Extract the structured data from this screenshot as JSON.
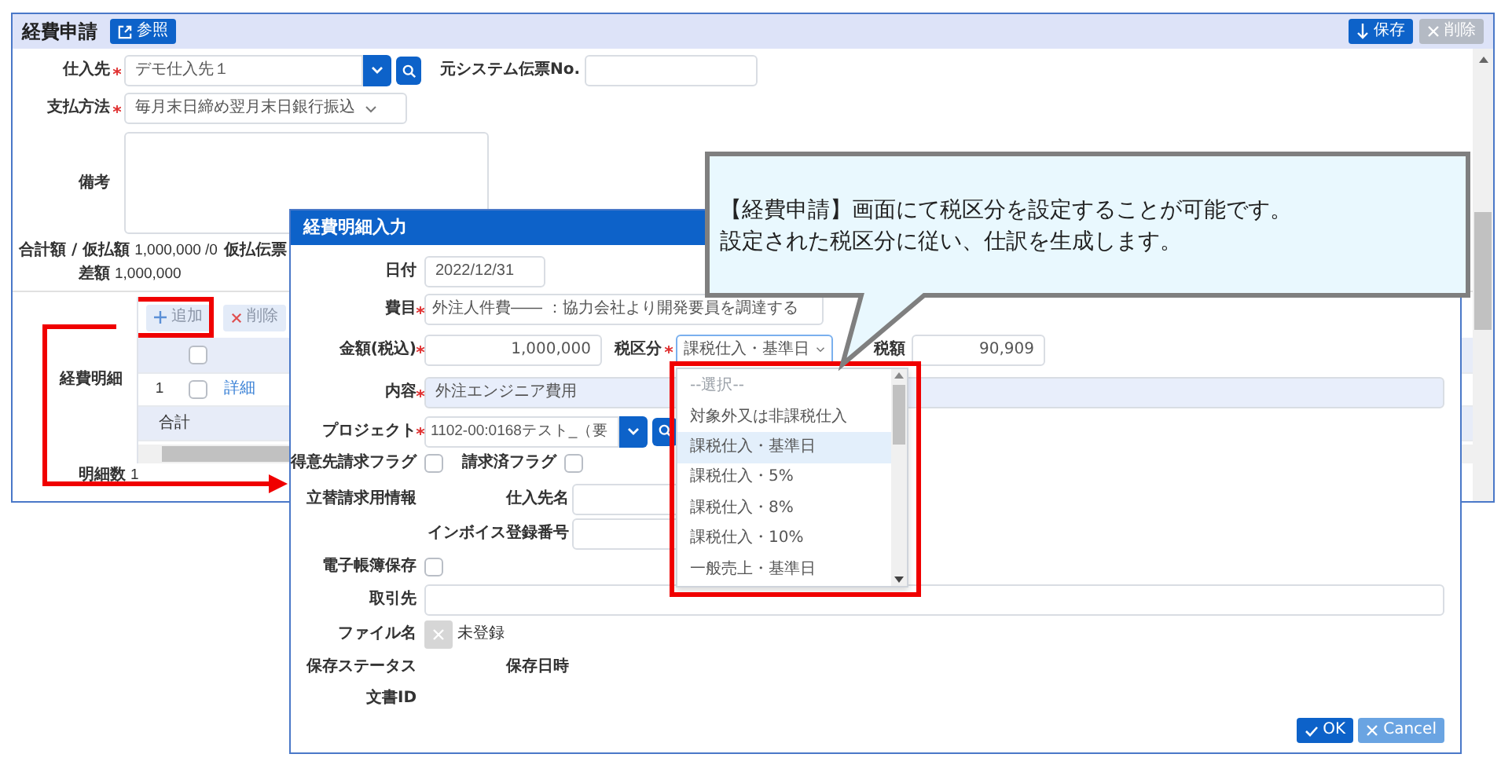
{
  "main_window": {
    "title": "経費申請",
    "reference_button": "参照",
    "save_button": "保存",
    "delete_button": {
      "label": "削除",
      "disabled": true
    },
    "supplier": {
      "label": "仕入先",
      "required": true,
      "value": "デモ仕入先１"
    },
    "source_slip": {
      "label": "元システム伝票No."
    },
    "payment": {
      "label": "支払方法",
      "required": true,
      "value": "毎月末日締め翌月末日銀行振込"
    },
    "notes": {
      "label": "備考"
    },
    "totals": {
      "label": "合計額 / 仮払額",
      "value": "1,000,000 /0",
      "advance_label": "仮払伝票"
    },
    "difference": {
      "label": "差額",
      "value": "1,000,000"
    },
    "details": {
      "label": "経費明細",
      "add_button": "追加",
      "delete_button": "削除",
      "header_checked": false,
      "total_label": "合計",
      "rows": [
        {
          "no": "1",
          "checked": false,
          "link": "詳細"
        }
      ]
    },
    "detail_count": {
      "label": "明細数",
      "value": "1"
    }
  },
  "dialog": {
    "title": "経費明細入力",
    "date": {
      "label": "日付",
      "value": "2022/12/31"
    },
    "expense_item": {
      "label": "費目",
      "required": true,
      "value": "外注人件費―― ：協力会社より開発要員を調達する"
    },
    "amount": {
      "label": "金額(税込)",
      "required": true,
      "value": "1,000,000"
    },
    "tax_category": {
      "label": "税区分",
      "required": true,
      "value": "課税仕入・基準日",
      "options": [
        {
          "label": "--選択--",
          "kind": "placeholder",
          "selected": false
        },
        {
          "label": "対象外又は非課税仕入",
          "kind": "option",
          "selected": false
        },
        {
          "label": "課税仕入・基準日",
          "kind": "option",
          "selected": true
        },
        {
          "label": "課税仕入・5%",
          "kind": "option",
          "selected": false
        },
        {
          "label": "課税仕入・8%",
          "kind": "option",
          "selected": false
        },
        {
          "label": "課税仕入・10%",
          "kind": "option",
          "selected": false
        },
        {
          "label": "一般売上・基準日",
          "kind": "option",
          "selected": false
        }
      ]
    },
    "tax_amount": {
      "label": "税額",
      "value": "90,909"
    },
    "content": {
      "label": "内容",
      "required": true,
      "value": "外注エンジニア費用"
    },
    "project": {
      "label": "プロジェクト",
      "required": true,
      "value": "1102-00:0168テスト_（要"
    },
    "customer_flag": {
      "label": "得意先請求フラグ",
      "checked": false
    },
    "billed_flag": {
      "label": "請求済フラグ",
      "checked": false
    },
    "advance_info": {
      "label": "立替請求用情報"
    },
    "vendor_name": {
      "label": "仕入先名"
    },
    "invoice_no": {
      "label": "インボイス登録番号"
    },
    "e_book": {
      "label": "電子帳簿保存",
      "checked": false
    },
    "partner": {
      "label": "取引先"
    },
    "file": {
      "label": "ファイル名",
      "value": "未登録"
    },
    "save_status": {
      "label": "保存ステータス"
    },
    "save_datetime": {
      "label": "保存日時"
    },
    "document_id": {
      "label": "文書ID"
    },
    "ok_button": "OK",
    "cancel_button": "Cancel"
  },
  "callout": {
    "lines": [
      "【経費申請】画面にて税区分を設定することが可能です。",
      "設定された税区分に従い、仕訳を生成します。"
    ]
  }
}
